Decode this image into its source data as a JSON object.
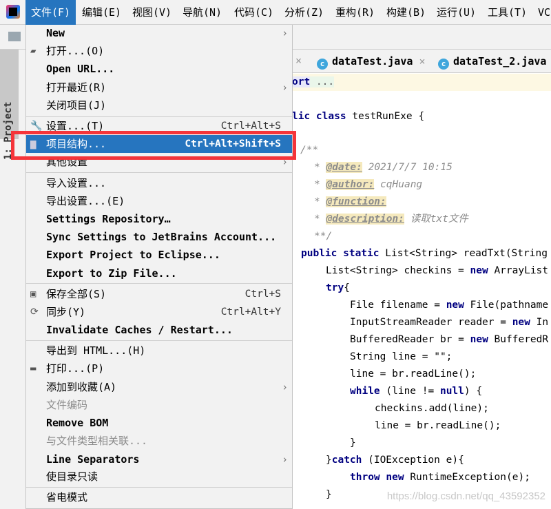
{
  "menubar": [
    "文件(F)",
    "编辑(E)",
    "视图(V)",
    "导航(N)",
    "代码(C)",
    "分析(Z)",
    "重构(R)",
    "构建(B)",
    "运行(U)",
    "工具(T)",
    "VC"
  ],
  "side_panel": "1: Project",
  "tabs": [
    "dataTest.java",
    "dataTest_2.java"
  ],
  "file_menu": {
    "items": [
      {
        "label": "New"
      },
      {
        "label": "打开...(O)"
      },
      {
        "label": "Open URL..."
      },
      {
        "label": "打开最近(R)"
      },
      {
        "label": "关闭项目(J)"
      },
      {
        "label": "设置...(T)",
        "shortcut": "Ctrl+Alt+S"
      },
      {
        "label": "项目结构...",
        "shortcut": "Ctrl+Alt+Shift+S"
      },
      {
        "label": "其他设置"
      },
      {
        "label": "导入设置..."
      },
      {
        "label": "导出设置...(E)"
      },
      {
        "label": "Settings Repository…"
      },
      {
        "label": "Sync Settings to JetBrains Account..."
      },
      {
        "label": "Export Project to Eclipse..."
      },
      {
        "label": "Export to Zip File..."
      },
      {
        "label": "保存全部(S)",
        "shortcut": "Ctrl+S"
      },
      {
        "label": "同步(Y)",
        "shortcut": "Ctrl+Alt+Y"
      },
      {
        "label": "Invalidate Caches / Restart..."
      },
      {
        "label": "导出到 HTML...(H)"
      },
      {
        "label": "打印...(P)"
      },
      {
        "label": "添加到收藏(A)"
      },
      {
        "label": "文件编码"
      },
      {
        "label": "Remove BOM"
      },
      {
        "label": "与文件类型相关联..."
      },
      {
        "label": "Line Separators"
      },
      {
        "label": "使目录只读"
      },
      {
        "label": "省电模式"
      }
    ]
  },
  "code": {
    "l1": [
      "ort",
      " ..."
    ],
    "l2": [
      "lic class",
      " testRunExe {"
    ],
    "l3": "/**",
    "date": [
      "@date:",
      " 2021/7/7 10:15"
    ],
    "author": [
      "@author:",
      " cqHuang"
    ],
    "func": "@function:",
    "desc": [
      "@description:",
      " 读取txt文件"
    ],
    "end": "**/",
    "l4": [
      "public static",
      " List<String> readTxt(String"
    ],
    "l5": [
      "List<String> checkins = ",
      "new",
      " ArrayList"
    ],
    "l6": [
      "try",
      "{"
    ],
    "l7": [
      "File filename = ",
      "new",
      " File(pathname"
    ],
    "l8": [
      "InputStreamReader reader = ",
      "new",
      " In"
    ],
    "l9": [
      "BufferedReader br = ",
      "new",
      " BufferedR"
    ],
    "l10": "String line = \"\";",
    "l11": "line = br.readLine();",
    "l12": [
      "while",
      " (line != ",
      "null",
      ") {"
    ],
    "l13": "checkins.add(line);",
    "l14": "line = br.readLine();",
    "l15": "}",
    "l16": [
      "}",
      "catch",
      " (IOException e){"
    ],
    "l17": [
      "throw ",
      "new",
      " RuntimeException(e);"
    ],
    "l18": "}"
  },
  "watermark": "https://blog.csdn.net/qq_43592352"
}
